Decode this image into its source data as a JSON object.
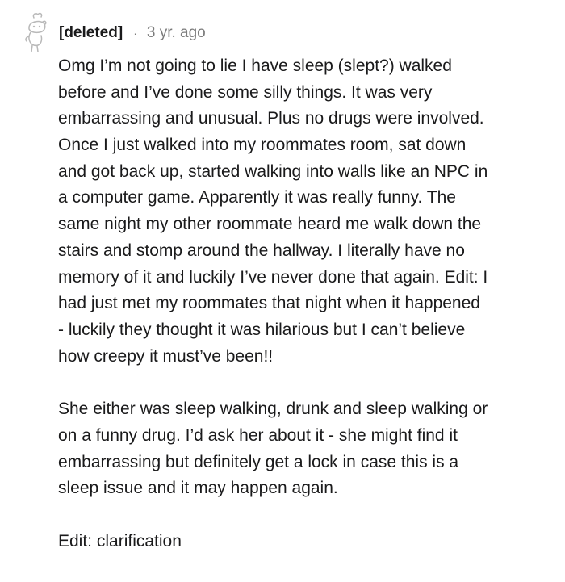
{
  "comment": {
    "author": "[deleted]",
    "separator": "·",
    "timestamp": "3 yr. ago",
    "avatar_icon": "snoo-avatar-icon",
    "paragraphs": [
      {
        "lines": [
          "Omg I’m not going to lie I have sleep (slept?) walked",
          "before and I’ve done some silly things. It was very",
          "embarrassing and unusual. Plus no drugs were involved.",
          "Once I just walked into my roommates room, sat down",
          "and got back up, started walking into walls like an NPC in",
          "a computer game. Apparently it was really funny. The",
          "same night my other roommate heard me walk down the",
          "stairs and stomp around the hallway. I literally have no",
          "memory of it and luckily I’ve never done that again. Edit: I",
          "had just met my roommates that night when it happened",
          "- luckily they thought it was hilarious but I can’t believe",
          "how creepy it must’ve been!!"
        ]
      },
      {
        "lines": [
          "She either was sleep walking, drunk and sleep walking or",
          "on a funny drug. I’d ask her about it - she might find it",
          "embarrassing but definitely get a lock in case this is a",
          "sleep issue and it may happen again."
        ]
      },
      {
        "lines": [
          "Edit: clarification"
        ]
      }
    ]
  }
}
